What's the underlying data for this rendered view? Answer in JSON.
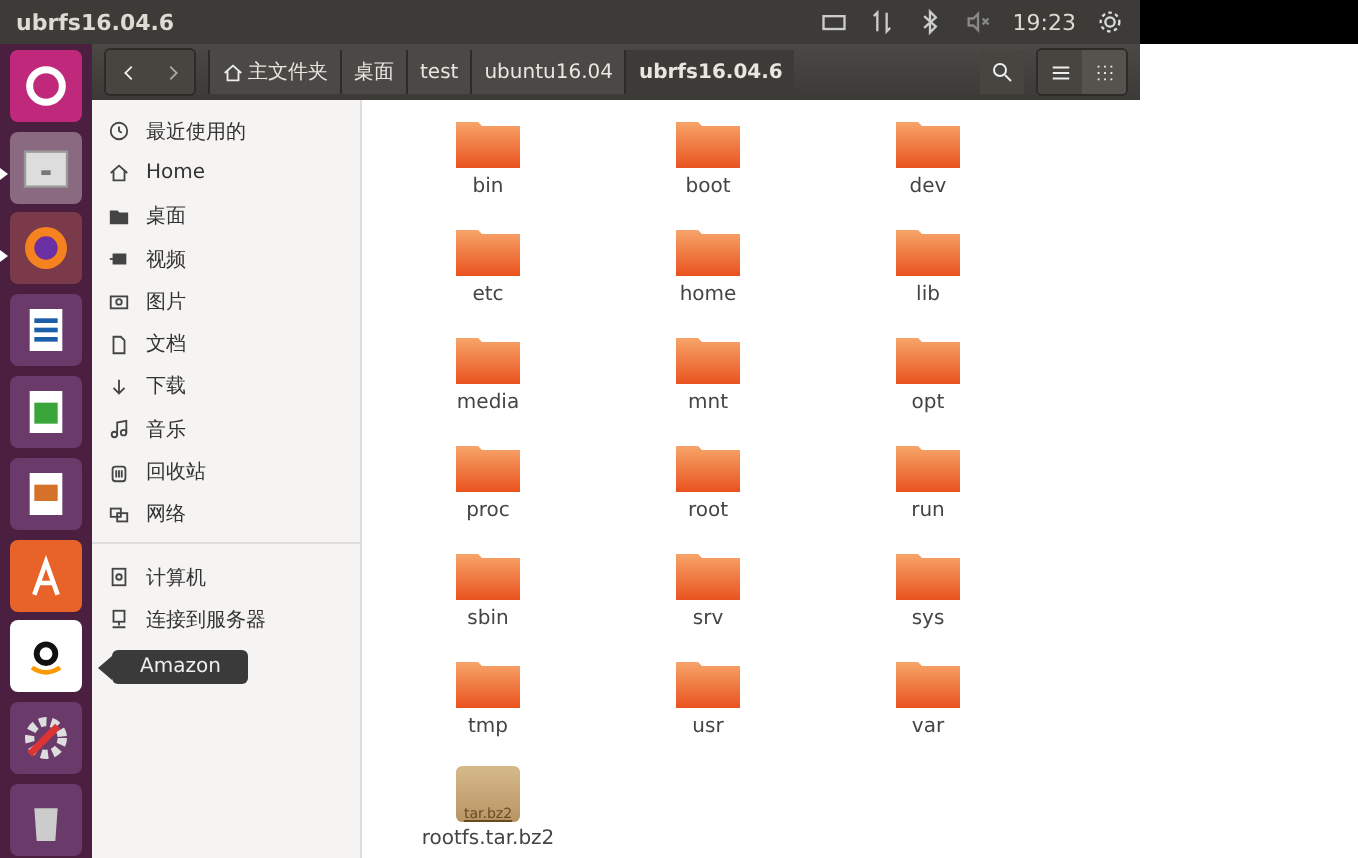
{
  "top_bar": {
    "title": "ubrfs16.04.6",
    "clock": "19:23"
  },
  "launcher": [
    {
      "kind": "ubuntu",
      "running": false
    },
    {
      "kind": "files",
      "running": true
    },
    {
      "kind": "firefox",
      "running": true
    },
    {
      "kind": "writer",
      "running": false
    },
    {
      "kind": "calc",
      "running": false
    },
    {
      "kind": "impress",
      "running": false
    },
    {
      "kind": "software",
      "running": false
    },
    {
      "kind": "amazon",
      "running": false
    },
    {
      "kind": "settings",
      "running": false
    },
    {
      "kind": "trash",
      "running": false
    }
  ],
  "tooltip": "Amazon",
  "breadcrumbs": [
    {
      "label": "主文件夹",
      "kind": "home",
      "selected": false
    },
    {
      "label": "桌面",
      "kind": "plain",
      "selected": false
    },
    {
      "label": "test",
      "kind": "plain",
      "selected": false
    },
    {
      "label": "ubuntu16.04",
      "kind": "plain",
      "selected": false
    },
    {
      "label": "ubrfs16.04.6",
      "kind": "plain",
      "selected": true
    }
  ],
  "view_buttons": [
    {
      "kind": "list",
      "selected": false
    },
    {
      "kind": "grid",
      "selected": true
    }
  ],
  "sidebar": {
    "groups": [
      [
        {
          "label": "最近使用的",
          "kind": "recent"
        },
        {
          "label": "Home",
          "kind": "home"
        },
        {
          "label": "桌面",
          "kind": "folder"
        },
        {
          "label": "视频",
          "kind": "video"
        },
        {
          "label": "图片",
          "kind": "camera"
        },
        {
          "label": "文档",
          "kind": "document"
        },
        {
          "label": "下载",
          "kind": "download"
        },
        {
          "label": "音乐",
          "kind": "music"
        },
        {
          "label": "回收站",
          "kind": "trash"
        },
        {
          "label": "网络",
          "kind": "network"
        }
      ],
      [
        {
          "label": "计算机",
          "kind": "drive"
        },
        {
          "label": "连接到服务器",
          "kind": "server"
        }
      ]
    ]
  },
  "files": [
    {
      "name": "bin",
      "kind": "folder"
    },
    {
      "name": "boot",
      "kind": "folder"
    },
    {
      "name": "dev",
      "kind": "folder"
    },
    {
      "name": "etc",
      "kind": "folder"
    },
    {
      "name": "home",
      "kind": "folder"
    },
    {
      "name": "lib",
      "kind": "folder"
    },
    {
      "name": "media",
      "kind": "folder"
    },
    {
      "name": "mnt",
      "kind": "folder"
    },
    {
      "name": "opt",
      "kind": "folder"
    },
    {
      "name": "proc",
      "kind": "folder"
    },
    {
      "name": "root",
      "kind": "folder"
    },
    {
      "name": "run",
      "kind": "folder"
    },
    {
      "name": "sbin",
      "kind": "folder"
    },
    {
      "name": "srv",
      "kind": "folder"
    },
    {
      "name": "sys",
      "kind": "folder"
    },
    {
      "name": "tmp",
      "kind": "folder"
    },
    {
      "name": "usr",
      "kind": "folder"
    },
    {
      "name": "var",
      "kind": "folder"
    },
    {
      "name": "rootfs.tar.bz2",
      "kind": "archive",
      "badge": "tar.bz2"
    }
  ]
}
